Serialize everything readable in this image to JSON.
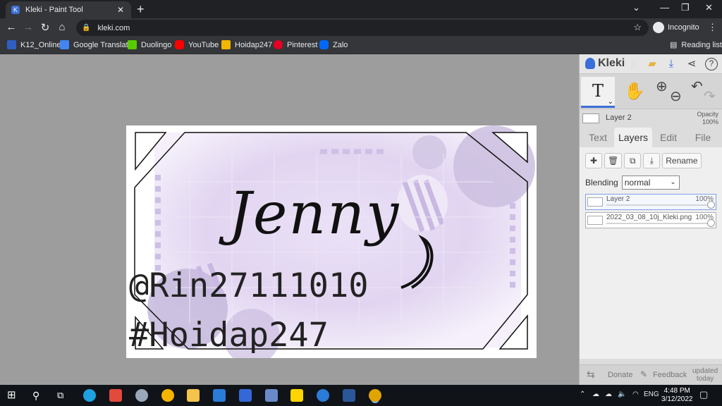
{
  "browser": {
    "tab_title": "Kleki - Paint Tool",
    "url": "kleki.com",
    "profile": "Incognito",
    "new_tab": "+",
    "tab_close": "✕",
    "bookmarks": [
      {
        "label": "K12_Online",
        "icon": "k12-icon",
        "color": "#2f5fc4"
      },
      {
        "label": "Google Translate",
        "icon": "translate-icon",
        "color": "#4285f4"
      },
      {
        "label": "Duolingo",
        "icon": "duolingo-icon",
        "color": "#58cc02"
      },
      {
        "label": "YouTube",
        "icon": "youtube-icon",
        "color": "#ff0000"
      },
      {
        "label": "Hoidap247",
        "icon": "hoidap-icon",
        "color": "#f2b600"
      },
      {
        "label": "Pinterest",
        "icon": "pinterest-icon",
        "color": "#e60023"
      },
      {
        "label": "Zalo",
        "icon": "zalo-icon",
        "color": "#0068ff"
      }
    ],
    "reading_list": "Reading list"
  },
  "canvas": {
    "title_text": "Jenny",
    "handle_text": "@Rin27111010",
    "hashtag_text": "#Hoidap247",
    "accent": "#c9b8e6"
  },
  "kleki": {
    "logo": "Kleki",
    "active_tool": "T",
    "current_layer": "Layer 2",
    "opacity_label": "Opacity",
    "opacity_value": "100%",
    "tabs": [
      "Text",
      "Layers",
      "Edit",
      "File"
    ],
    "active_tab": "Layers",
    "rename_label": "Rename",
    "blending_label": "Blending",
    "blending_value": "normal",
    "layers": [
      {
        "name": "Layer 2",
        "opacity": "100%",
        "selected": true
      },
      {
        "name": "2022_03_08_10j_Kleki.png",
        "opacity": "100%",
        "selected": false
      }
    ],
    "footer": {
      "donate": "Donate",
      "feedback": "Feedback",
      "updated": "updated",
      "updated_when": "today"
    }
  },
  "taskbar": {
    "language": "ENG",
    "time": "4:48 PM",
    "date": "3/12/2022"
  }
}
